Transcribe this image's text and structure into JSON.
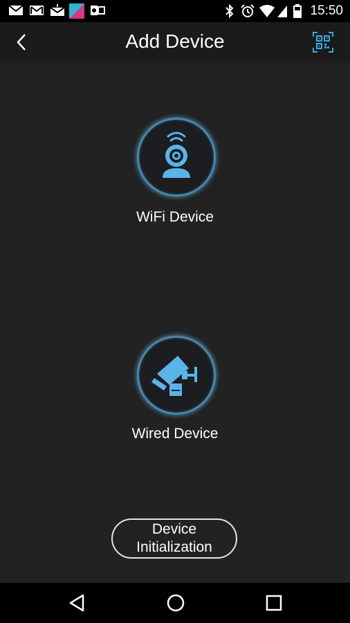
{
  "status_bar": {
    "time": "15:50",
    "left_icons": [
      "mail-icon",
      "gmail-icon",
      "gmail-icon",
      "app-notification-icon",
      "outlook-icon"
    ],
    "right_icons": [
      "bluetooth-icon",
      "alarm-icon",
      "wifi-icon",
      "signal-icon",
      "battery-icon"
    ]
  },
  "app_bar": {
    "title": "Add Device",
    "back_icon": "back-chevron-icon",
    "qr_icon": "qr-scan-icon",
    "accent_color": "#3aa9e0"
  },
  "devices": [
    {
      "label": "WiFi Device",
      "icon": "wifi-camera-icon"
    },
    {
      "label": "Wired Device",
      "icon": "wired-camera-icon"
    }
  ],
  "init_button": {
    "line1": "Device",
    "line2": "Initialization"
  },
  "nav_bar": {
    "back_icon": "nav-back-icon",
    "home_icon": "nav-home-icon",
    "recents_icon": "nav-recents-icon"
  },
  "colors": {
    "background": "#222222",
    "app_bar": "#1b1b1b",
    "icon_blue": "#5ab4ea",
    "ring": "#4b86a8"
  }
}
